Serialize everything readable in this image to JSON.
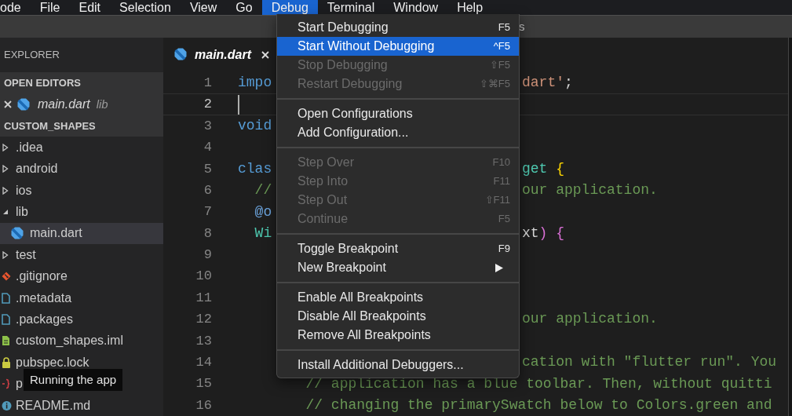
{
  "menubar": {
    "items": [
      {
        "label": "ode",
        "selected": false
      },
      {
        "label": "File",
        "selected": false
      },
      {
        "label": "Edit",
        "selected": false
      },
      {
        "label": "Selection",
        "selected": false
      },
      {
        "label": "View",
        "selected": false
      },
      {
        "label": "Go",
        "selected": false
      },
      {
        "label": "Debug",
        "selected": true
      },
      {
        "label": "Terminal",
        "selected": false
      },
      {
        "label": "Window",
        "selected": false
      },
      {
        "label": "Help",
        "selected": false
      }
    ]
  },
  "window": {
    "title": "s"
  },
  "sidebar": {
    "title": "EXPLORER",
    "open_editors": {
      "title": "OPEN EDITORS",
      "items": [
        {
          "name": "main.dart",
          "folder": "lib",
          "kind": "dart"
        }
      ]
    },
    "project": {
      "title": "CUSTOM_SHAPES",
      "tree": [
        {
          "name": ".idea",
          "kind": "folder",
          "expanded": false,
          "selected": false
        },
        {
          "name": "android",
          "kind": "folder",
          "expanded": false,
          "selected": false
        },
        {
          "name": "ios",
          "kind": "folder",
          "expanded": false,
          "selected": false
        },
        {
          "name": "lib",
          "kind": "folder",
          "expanded": true,
          "selected": false,
          "children": [
            {
              "name": "main.dart",
              "kind": "dart",
              "selected": true
            }
          ]
        },
        {
          "name": "test",
          "kind": "folder",
          "expanded": false,
          "selected": false
        },
        {
          "name": ".gitignore",
          "kind": "git",
          "selected": false
        },
        {
          "name": ".metadata",
          "kind": "file",
          "selected": false
        },
        {
          "name": ".packages",
          "kind": "file",
          "selected": false
        },
        {
          "name": "custom_shapes.iml",
          "kind": "iml",
          "selected": false
        },
        {
          "name": "pubspec.lock",
          "kind": "lock",
          "selected": false
        },
        {
          "name": "p",
          "kind": "yaml",
          "selected": false
        },
        {
          "name": "README.md",
          "kind": "info",
          "selected": false
        }
      ]
    }
  },
  "editor": {
    "tabs": [
      {
        "label": "main.dart",
        "kind": "dart",
        "selected": true
      }
    ],
    "lines": [
      {
        "number": "1",
        "current": false,
        "left": [
          {
            "text": "impo",
            "kind": "keyword"
          }
        ],
        "right": [
          {
            "text": "dart'",
            "kind": "string"
          },
          {
            "text": ";",
            "kind": "plain"
          }
        ]
      },
      {
        "number": "2",
        "current": true
      },
      {
        "number": "3",
        "current": false,
        "left": [
          {
            "text": "void",
            "kind": "keyword"
          }
        ]
      },
      {
        "number": "4",
        "current": false
      },
      {
        "number": "5",
        "current": false,
        "left": [
          {
            "text": "clas",
            "kind": "keyword"
          }
        ],
        "right": [
          {
            "text": "get ",
            "kind": "type"
          },
          {
            "text": "{",
            "kind": "bracket"
          }
        ]
      },
      {
        "number": "6",
        "current": false,
        "left": [
          {
            "text": "  //",
            "kind": "comment"
          }
        ],
        "right": [
          {
            "text": "our application.",
            "kind": "comment"
          }
        ]
      },
      {
        "number": "7",
        "current": false,
        "left": [
          {
            "text": "  @o",
            "kind": "annotation"
          }
        ]
      },
      {
        "number": "8",
        "current": false,
        "left": [
          {
            "text": "  Wi",
            "kind": "type"
          }
        ],
        "right": [
          {
            "text": "xt",
            "kind": "plain"
          },
          {
            "text": ") {",
            "kind": "bracket2"
          }
        ]
      },
      {
        "number": "9",
        "current": false
      },
      {
        "number": "10",
        "current": false
      },
      {
        "number": "11",
        "current": false
      },
      {
        "number": "12",
        "current": false,
        "right": [
          {
            "text": "our application.",
            "kind": "comment"
          }
        ]
      },
      {
        "number": "13",
        "current": false
      },
      {
        "number": "14",
        "current": false,
        "right": [
          {
            "text": "cation with \"flutter run\". You",
            "kind": "comment"
          }
        ]
      },
      {
        "number": "15",
        "current": false,
        "left": [
          {
            "text": "        // application has a blue toolbar. Then, without quitti",
            "kind": "comment"
          }
        ]
      },
      {
        "number": "16",
        "current": false,
        "left": [
          {
            "text": "        // changing the primarySwatch below to Colors.green and",
            "kind": "comment"
          }
        ]
      }
    ]
  },
  "debug_menu": {
    "groups": [
      {
        "items": [
          {
            "label": "Start Debugging",
            "shortcut": "F5",
            "disabled": false,
            "selected": false
          },
          {
            "label": "Start Without Debugging",
            "shortcut": "^F5",
            "disabled": false,
            "selected": true
          },
          {
            "label": "Stop Debugging",
            "shortcut": "⇧F5",
            "disabled": true,
            "selected": false
          },
          {
            "label": "Restart Debugging",
            "shortcut": "⇧⌘F5",
            "disabled": true,
            "selected": false
          }
        ]
      },
      {
        "items": [
          {
            "label": "Open Configurations",
            "disabled": false,
            "selected": false
          },
          {
            "label": "Add Configuration...",
            "disabled": false,
            "selected": false
          }
        ]
      },
      {
        "items": [
          {
            "label": "Step Over",
            "shortcut": "F10",
            "disabled": true,
            "selected": false
          },
          {
            "label": "Step Into",
            "shortcut": "F11",
            "disabled": true,
            "selected": false
          },
          {
            "label": "Step Out",
            "shortcut": "⇧F11",
            "disabled": true,
            "selected": false
          },
          {
            "label": "Continue",
            "shortcut": "F5",
            "disabled": true,
            "selected": false
          }
        ]
      },
      {
        "items": [
          {
            "label": "Toggle Breakpoint",
            "shortcut": "F9",
            "disabled": false,
            "selected": false
          },
          {
            "label": "New Breakpoint",
            "submenu": true,
            "disabled": false,
            "selected": false
          }
        ]
      },
      {
        "items": [
          {
            "label": "Enable All Breakpoints",
            "disabled": false,
            "selected": false
          },
          {
            "label": "Disable All Breakpoints",
            "disabled": false,
            "selected": false
          },
          {
            "label": "Remove All Breakpoints",
            "disabled": false,
            "selected": false
          }
        ]
      },
      {
        "items": [
          {
            "label": "Install Additional Debuggers...",
            "disabled": false,
            "selected": false
          }
        ]
      }
    ]
  },
  "tooltip": {
    "text": "Running the app"
  }
}
